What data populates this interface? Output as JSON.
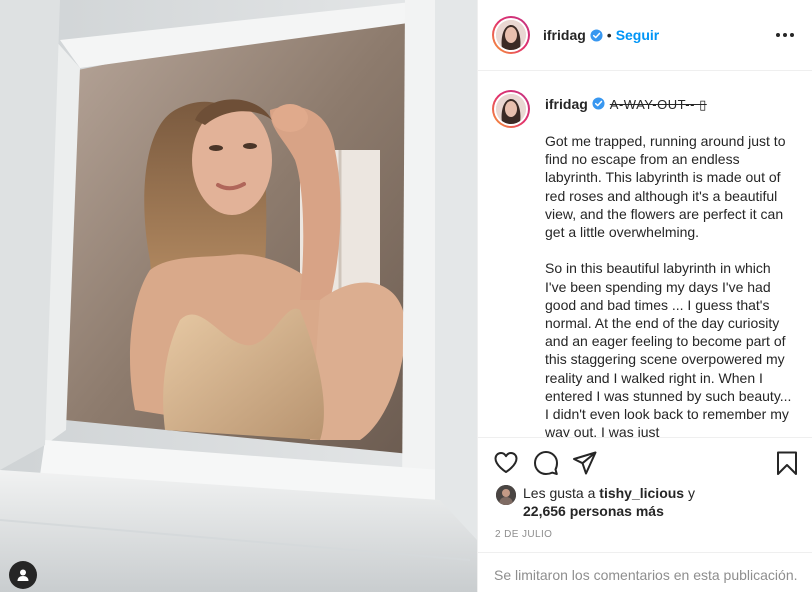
{
  "post": {
    "username": "ifridag",
    "verified": true,
    "separator": "•",
    "follow_label": "Seguir"
  },
  "caption": {
    "username": "ifridag",
    "title": "A-WAY-OUT-- ▯",
    "text": "Got me trapped, running around just to find no escape from an endless labyrinth. This labyrinth is made out of red roses and although it's a beautiful view, and the flowers are perfect it can get a little overwhelming.\n\nSo in this beautiful labyrinth in which I've been spending my days I've had good and bad times ... I guess that's normal. At the end of the day curiosity and an eager feeling to become part of this staggering scene overpowered my reality and I walked right in. When I entered I was stunned by such beauty... I didn't even look back to remember my way out, I was just"
  },
  "likes": {
    "prefix": "Les gusta a ",
    "first_user": "tishy_licious",
    "connector": " y",
    "count": "22,656 personas más"
  },
  "date": "2 DE JULIO",
  "comments_disabled": "Se limitaron los comentarios en esta publicación.",
  "icons": {
    "like": "heart-icon",
    "comment": "comment-icon",
    "share": "share-icon",
    "save": "bookmark-icon",
    "more": "more-options-icon",
    "verified": "verified-badge-icon",
    "tags": "user-tag-icon"
  },
  "colors": {
    "accent": "#0095f6",
    "verified": "#3897f0",
    "muted": "#8e8e8e",
    "text": "#262626",
    "border": "#efefef"
  }
}
